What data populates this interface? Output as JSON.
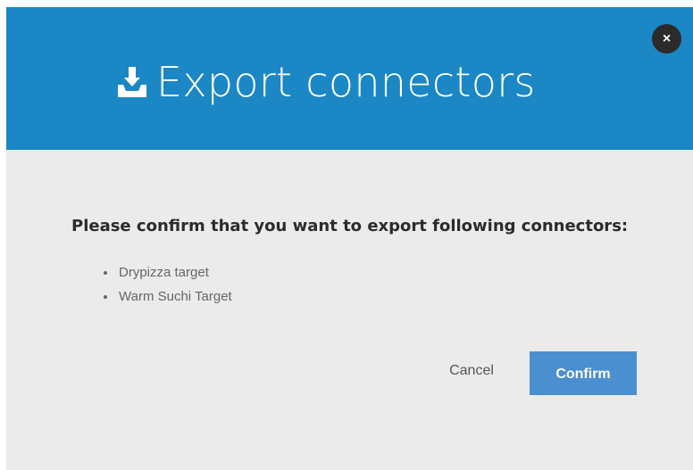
{
  "dialog": {
    "title": "Export connectors",
    "close_label": "×",
    "prompt": "Please confirm that you want to export following connectors:",
    "connectors": [
      "Drypizza target",
      "Warm Suchi Target"
    ],
    "cancel_label": "Cancel",
    "confirm_label": "Confirm"
  },
  "icons": {
    "title_icon": "export-tray-icon",
    "close_icon": "close-icon"
  },
  "colors": {
    "header": "#1b87c4",
    "body": "#ebebeb",
    "confirm": "#4a8fd0",
    "close_button": "#2b2b2b"
  }
}
